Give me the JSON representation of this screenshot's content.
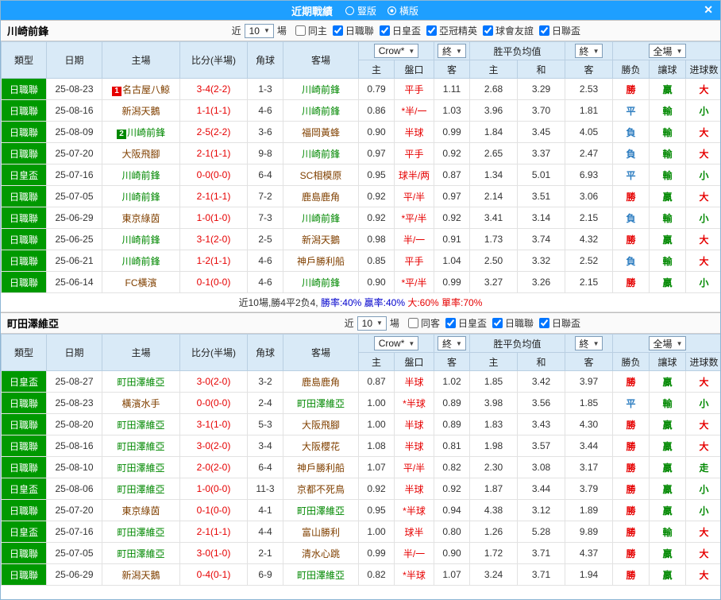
{
  "topbar": {
    "title": "近期戰績",
    "radio_vertical": "豎版",
    "radio_horizontal": "橫版",
    "close": "✕"
  },
  "icons": {
    "dropdown_arrow": "▼"
  },
  "filter_labels": {
    "near": "近",
    "games": "場"
  },
  "table_header": {
    "type": "類型",
    "date": "日期",
    "home": "主場",
    "score": "比分(半場)",
    "corner": "角球",
    "away": "客場",
    "company": "Crow*",
    "final": "終",
    "avg_label": "胜平负均值",
    "full_label": "全場",
    "sub_home": "主",
    "sub_handicap": "盤口",
    "sub_away": "客",
    "sub_avg_home": "主",
    "sub_avg_draw": "和",
    "sub_avg_away": "客",
    "sub_result": "勝负",
    "sub_handicap_result": "讓球",
    "sub_goals": "进球数"
  },
  "colors": {
    "topbar_bg": "#1e9fff",
    "league_bg": "#009900",
    "focus_team": "#008800",
    "other_team": "#804000",
    "score": "#e60000",
    "handicap": "#e60000"
  },
  "result_colors": {
    "勝": "#e60000",
    "平": "#2b7cc0",
    "負": "#2b7cc0",
    "贏": "#008800",
    "輸": "#008800",
    "大": "#e60000",
    "小": "#008800",
    "走": "#008800"
  },
  "sections": [
    {
      "team": "川崎前鋒",
      "near_count": "10",
      "checkboxes": [
        {
          "label": "同主",
          "checked": false
        },
        {
          "label": "日職聯",
          "checked": true
        },
        {
          "label": "日皇盃",
          "checked": true
        },
        {
          "label": "亞冠精英",
          "checked": true
        },
        {
          "label": "球會友誼",
          "checked": true
        },
        {
          "label": "日聯盃",
          "checked": true
        }
      ],
      "rows": [
        {
          "league": "日職聯",
          "date": "25-08-23",
          "home": {
            "name": "名古屋八鯨",
            "badge": "1",
            "badge_color": "#e60000",
            "focus": false
          },
          "score": "3-4(2-2)",
          "corner": "1-3",
          "away": {
            "name": "川崎前鋒",
            "focus": true
          },
          "odds": [
            "0.79",
            "平手",
            "1.11"
          ],
          "avg": [
            "2.68",
            "3.29",
            "2.53"
          ],
          "results": [
            "勝",
            "贏",
            "大"
          ]
        },
        {
          "league": "日職聯",
          "date": "25-08-16",
          "home": {
            "name": "新潟天鵝",
            "focus": false
          },
          "score": "1-1(1-1)",
          "corner": "4-6",
          "away": {
            "name": "川崎前鋒",
            "focus": true
          },
          "odds": [
            "0.86",
            "*半/一",
            "1.03"
          ],
          "avg": [
            "3.96",
            "3.70",
            "1.81"
          ],
          "results": [
            "平",
            "輸",
            "小"
          ]
        },
        {
          "league": "日職聯",
          "date": "25-08-09",
          "home": {
            "name": "川崎前鋒",
            "badge": "2",
            "badge_color": "#008800",
            "focus": true
          },
          "score": "2-5(2-2)",
          "corner": "3-6",
          "away": {
            "name": "福岡黃蜂",
            "focus": false
          },
          "odds": [
            "0.90",
            "半球",
            "0.99"
          ],
          "avg": [
            "1.84",
            "3.45",
            "4.05"
          ],
          "results": [
            "負",
            "輸",
            "大"
          ]
        },
        {
          "league": "日職聯",
          "date": "25-07-20",
          "home": {
            "name": "大阪飛腳",
            "focus": false
          },
          "score": "2-1(1-1)",
          "corner": "9-8",
          "away": {
            "name": "川崎前鋒",
            "focus": true
          },
          "odds": [
            "0.97",
            "平手",
            "0.92"
          ],
          "avg": [
            "2.65",
            "3.37",
            "2.47"
          ],
          "results": [
            "負",
            "輸",
            "大"
          ]
        },
        {
          "league": "日皇盃",
          "date": "25-07-16",
          "home": {
            "name": "川崎前鋒",
            "focus": true
          },
          "score": "0-0(0-0)",
          "corner": "6-4",
          "away": {
            "name": "SC相模原",
            "focus": false
          },
          "odds": [
            "0.95",
            "球半/两",
            "0.87"
          ],
          "avg": [
            "1.34",
            "5.01",
            "6.93"
          ],
          "results": [
            "平",
            "輸",
            "小"
          ]
        },
        {
          "league": "日職聯",
          "date": "25-07-05",
          "home": {
            "name": "川崎前鋒",
            "focus": true
          },
          "score": "2-1(1-1)",
          "corner": "7-2",
          "away": {
            "name": "鹿島鹿角",
            "focus": false
          },
          "odds": [
            "0.92",
            "平/半",
            "0.97"
          ],
          "avg": [
            "2.14",
            "3.51",
            "3.06"
          ],
          "results": [
            "勝",
            "贏",
            "大"
          ]
        },
        {
          "league": "日職聯",
          "date": "25-06-29",
          "home": {
            "name": "東京綠茵",
            "focus": false
          },
          "score": "1-0(1-0)",
          "corner": "7-3",
          "away": {
            "name": "川崎前鋒",
            "focus": true
          },
          "odds": [
            "0.92",
            "*平/半",
            "0.92"
          ],
          "avg": [
            "3.41",
            "3.14",
            "2.15"
          ],
          "results": [
            "負",
            "輸",
            "小"
          ]
        },
        {
          "league": "日職聯",
          "date": "25-06-25",
          "home": {
            "name": "川崎前鋒",
            "focus": true
          },
          "score": "3-1(2-0)",
          "corner": "2-5",
          "away": {
            "name": "新潟天鵝",
            "focus": false
          },
          "odds": [
            "0.98",
            "半/一",
            "0.91"
          ],
          "avg": [
            "1.73",
            "3.74",
            "4.32"
          ],
          "results": [
            "勝",
            "贏",
            "大"
          ]
        },
        {
          "league": "日職聯",
          "date": "25-06-21",
          "home": {
            "name": "川崎前鋒",
            "focus": true
          },
          "score": "1-2(1-1)",
          "corner": "4-6",
          "away": {
            "name": "神戶勝利船",
            "focus": false
          },
          "odds": [
            "0.85",
            "平手",
            "1.04"
          ],
          "avg": [
            "2.50",
            "3.32",
            "2.52"
          ],
          "results": [
            "負",
            "輸",
            "大"
          ]
        },
        {
          "league": "日職聯",
          "date": "25-06-14",
          "home": {
            "name": "FC橫濱",
            "focus": false
          },
          "score": "0-1(0-0)",
          "corner": "4-6",
          "away": {
            "name": "川崎前鋒",
            "focus": true
          },
          "odds": [
            "0.90",
            "*平/半",
            "0.99"
          ],
          "avg": [
            "3.27",
            "3.26",
            "2.15"
          ],
          "results": [
            "勝",
            "贏",
            "小"
          ]
        }
      ],
      "summary": [
        {
          "text": "近10場,勝4平2负4, ",
          "color": "#333333"
        },
        {
          "text": "勝率:40% ",
          "color": "#0000cc"
        },
        {
          "text": "贏率:40% ",
          "color": "#0000cc"
        },
        {
          "text": "大:60% ",
          "color": "#e60000"
        },
        {
          "text": "單率:70%",
          "color": "#e60000"
        }
      ]
    },
    {
      "team": "町田澤維亞",
      "near_count": "10",
      "checkboxes": [
        {
          "label": "同客",
          "checked": false
        },
        {
          "label": "日皇盃",
          "checked": true
        },
        {
          "label": "日職聯",
          "checked": true
        },
        {
          "label": "日聯盃",
          "checked": true
        }
      ],
      "rows": [
        {
          "league": "日皇盃",
          "date": "25-08-27",
          "home": {
            "name": "町田澤維亞",
            "focus": true
          },
          "score": "3-0(2-0)",
          "corner": "3-2",
          "away": {
            "name": "鹿島鹿角",
            "focus": false
          },
          "odds": [
            "0.87",
            "半球",
            "1.02"
          ],
          "avg": [
            "1.85",
            "3.42",
            "3.97"
          ],
          "results": [
            "勝",
            "贏",
            "大"
          ]
        },
        {
          "league": "日職聯",
          "date": "25-08-23",
          "home": {
            "name": "橫濱水手",
            "focus": false
          },
          "score": "0-0(0-0)",
          "corner": "2-4",
          "away": {
            "name": "町田澤維亞",
            "focus": true
          },
          "odds": [
            "1.00",
            "*半球",
            "0.89"
          ],
          "avg": [
            "3.98",
            "3.56",
            "1.85"
          ],
          "results": [
            "平",
            "輸",
            "小"
          ]
        },
        {
          "league": "日職聯",
          "date": "25-08-20",
          "home": {
            "name": "町田澤維亞",
            "focus": true
          },
          "score": "3-1(1-0)",
          "corner": "5-3",
          "away": {
            "name": "大阪飛腳",
            "focus": false
          },
          "odds": [
            "1.00",
            "半球",
            "0.89"
          ],
          "avg": [
            "1.83",
            "3.43",
            "4.30"
          ],
          "results": [
            "勝",
            "贏",
            "大"
          ]
        },
        {
          "league": "日職聯",
          "date": "25-08-16",
          "home": {
            "name": "町田澤維亞",
            "focus": true
          },
          "score": "3-0(2-0)",
          "corner": "3-4",
          "away": {
            "name": "大阪櫻花",
            "focus": false
          },
          "odds": [
            "1.08",
            "半球",
            "0.81"
          ],
          "avg": [
            "1.98",
            "3.57",
            "3.44"
          ],
          "results": [
            "勝",
            "贏",
            "大"
          ]
        },
        {
          "league": "日職聯",
          "date": "25-08-10",
          "home": {
            "name": "町田澤維亞",
            "focus": true
          },
          "score": "2-0(2-0)",
          "corner": "6-4",
          "away": {
            "name": "神戶勝利船",
            "focus": false
          },
          "odds": [
            "1.07",
            "平/半",
            "0.82"
          ],
          "avg": [
            "2.30",
            "3.08",
            "3.17"
          ],
          "results": [
            "勝",
            "贏",
            "走"
          ]
        },
        {
          "league": "日皇盃",
          "date": "25-08-06",
          "home": {
            "name": "町田澤維亞",
            "focus": true
          },
          "score": "1-0(0-0)",
          "corner": "11-3",
          "away": {
            "name": "京都不死鳥",
            "focus": false
          },
          "odds": [
            "0.92",
            "半球",
            "0.92"
          ],
          "avg": [
            "1.87",
            "3.44",
            "3.79"
          ],
          "results": [
            "勝",
            "贏",
            "小"
          ]
        },
        {
          "league": "日職聯",
          "date": "25-07-20",
          "home": {
            "name": "東京綠茵",
            "focus": false
          },
          "score": "0-1(0-0)",
          "corner": "4-1",
          "away": {
            "name": "町田澤維亞",
            "focus": true
          },
          "odds": [
            "0.95",
            "*半球",
            "0.94"
          ],
          "avg": [
            "4.38",
            "3.12",
            "1.89"
          ],
          "results": [
            "勝",
            "贏",
            "小"
          ]
        },
        {
          "league": "日皇盃",
          "date": "25-07-16",
          "home": {
            "name": "町田澤維亞",
            "focus": true
          },
          "score": "2-1(1-1)",
          "corner": "4-4",
          "away": {
            "name": "富山勝利",
            "focus": false
          },
          "odds": [
            "1.00",
            "球半",
            "0.80"
          ],
          "avg": [
            "1.26",
            "5.28",
            "9.89"
          ],
          "results": [
            "勝",
            "輸",
            "大"
          ]
        },
        {
          "league": "日職聯",
          "date": "25-07-05",
          "home": {
            "name": "町田澤維亞",
            "focus": true
          },
          "score": "3-0(1-0)",
          "corner": "2-1",
          "away": {
            "name": "清水心跳",
            "focus": false
          },
          "odds": [
            "0.99",
            "半/一",
            "0.90"
          ],
          "avg": [
            "1.72",
            "3.71",
            "4.37"
          ],
          "results": [
            "勝",
            "贏",
            "大"
          ]
        },
        {
          "league": "日職聯",
          "date": "25-06-29",
          "home": {
            "name": "新潟天鵝",
            "focus": false
          },
          "score": "0-4(0-1)",
          "corner": "6-9",
          "away": {
            "name": "町田澤維亞",
            "focus": true
          },
          "odds": [
            "0.82",
            "*半球",
            "1.07"
          ],
          "avg": [
            "3.24",
            "3.71",
            "1.94"
          ],
          "results": [
            "勝",
            "贏",
            "大"
          ]
        }
      ]
    }
  ]
}
